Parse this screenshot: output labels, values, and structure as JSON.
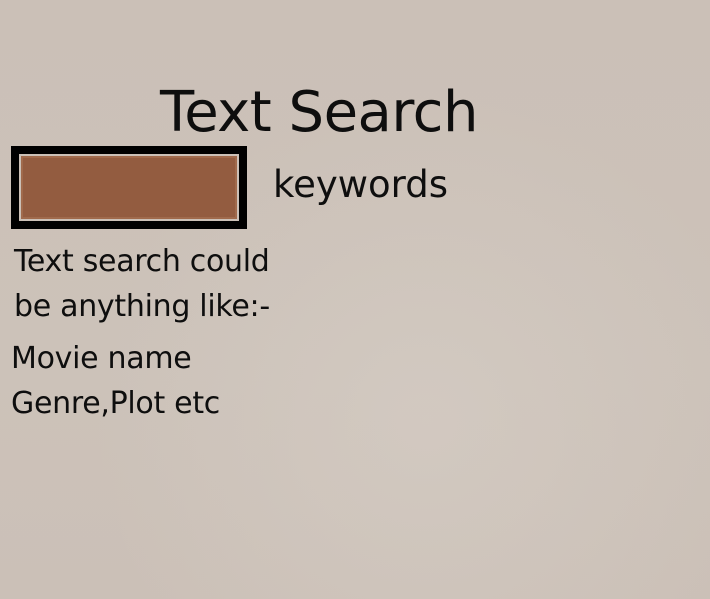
{
  "header": {
    "title": "Text Search"
  },
  "search": {
    "value": "",
    "label": "keywords",
    "field_color": "#935c40",
    "border_color": "#000000"
  },
  "hint": {
    "line1": "Text search could",
    "line2": "be anything like:-"
  },
  "examples": [
    "Movie name",
    "Genre,Plot etc"
  ],
  "colors": {
    "background": "#cbc0b7",
    "text": "#0e0e0e"
  }
}
